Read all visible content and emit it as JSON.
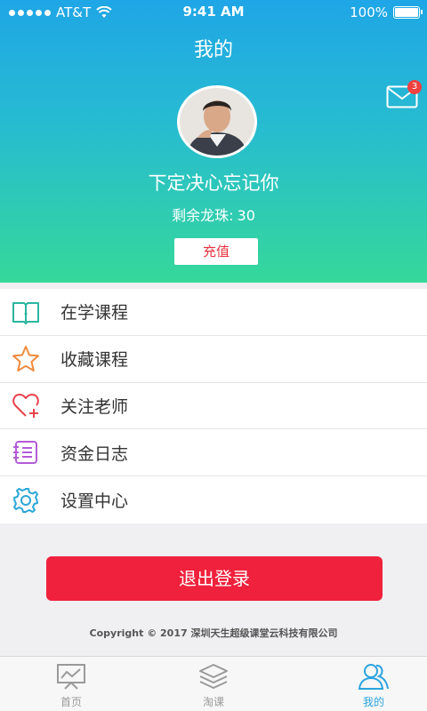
{
  "status_bar": {
    "carrier": "AT&T",
    "time": "9:41 AM",
    "battery": "100%",
    "battery_level": 1.0
  },
  "header": {
    "title": "我的",
    "mail_badge": "3"
  },
  "profile": {
    "name": "下定决心忘记你",
    "coins_label": "剩余龙珠:",
    "coins_value": "30",
    "recharge_label": "充值"
  },
  "menu": [
    {
      "label": "在学课程",
      "icon": "open-book-icon",
      "color": "#2bb6a0"
    },
    {
      "label": "收藏课程",
      "icon": "star-icon",
      "color": "#f08a3c"
    },
    {
      "label": "关注老师",
      "icon": "heart-plus-icon",
      "color": "#e8434c"
    },
    {
      "label": "资金日志",
      "icon": "ledger-icon",
      "color": "#b35bd8"
    },
    {
      "label": "设置中心",
      "icon": "gear-icon",
      "color": "#2aa6d6"
    }
  ],
  "logout_label": "退出登录",
  "copyright": "Copyright © 2017 深圳天生超级课堂云科技有限公司",
  "tabs": [
    {
      "label": "首页",
      "icon": "chart-board-icon",
      "active": false
    },
    {
      "label": "淘课",
      "icon": "layers-icon",
      "active": false
    },
    {
      "label": "我的",
      "icon": "users-icon",
      "active": true
    }
  ],
  "colors": {
    "accent_red": "#f0213c",
    "header_top": "#1fa6e6",
    "header_bottom": "#36d89a",
    "tab_active": "#2aa3e0"
  }
}
